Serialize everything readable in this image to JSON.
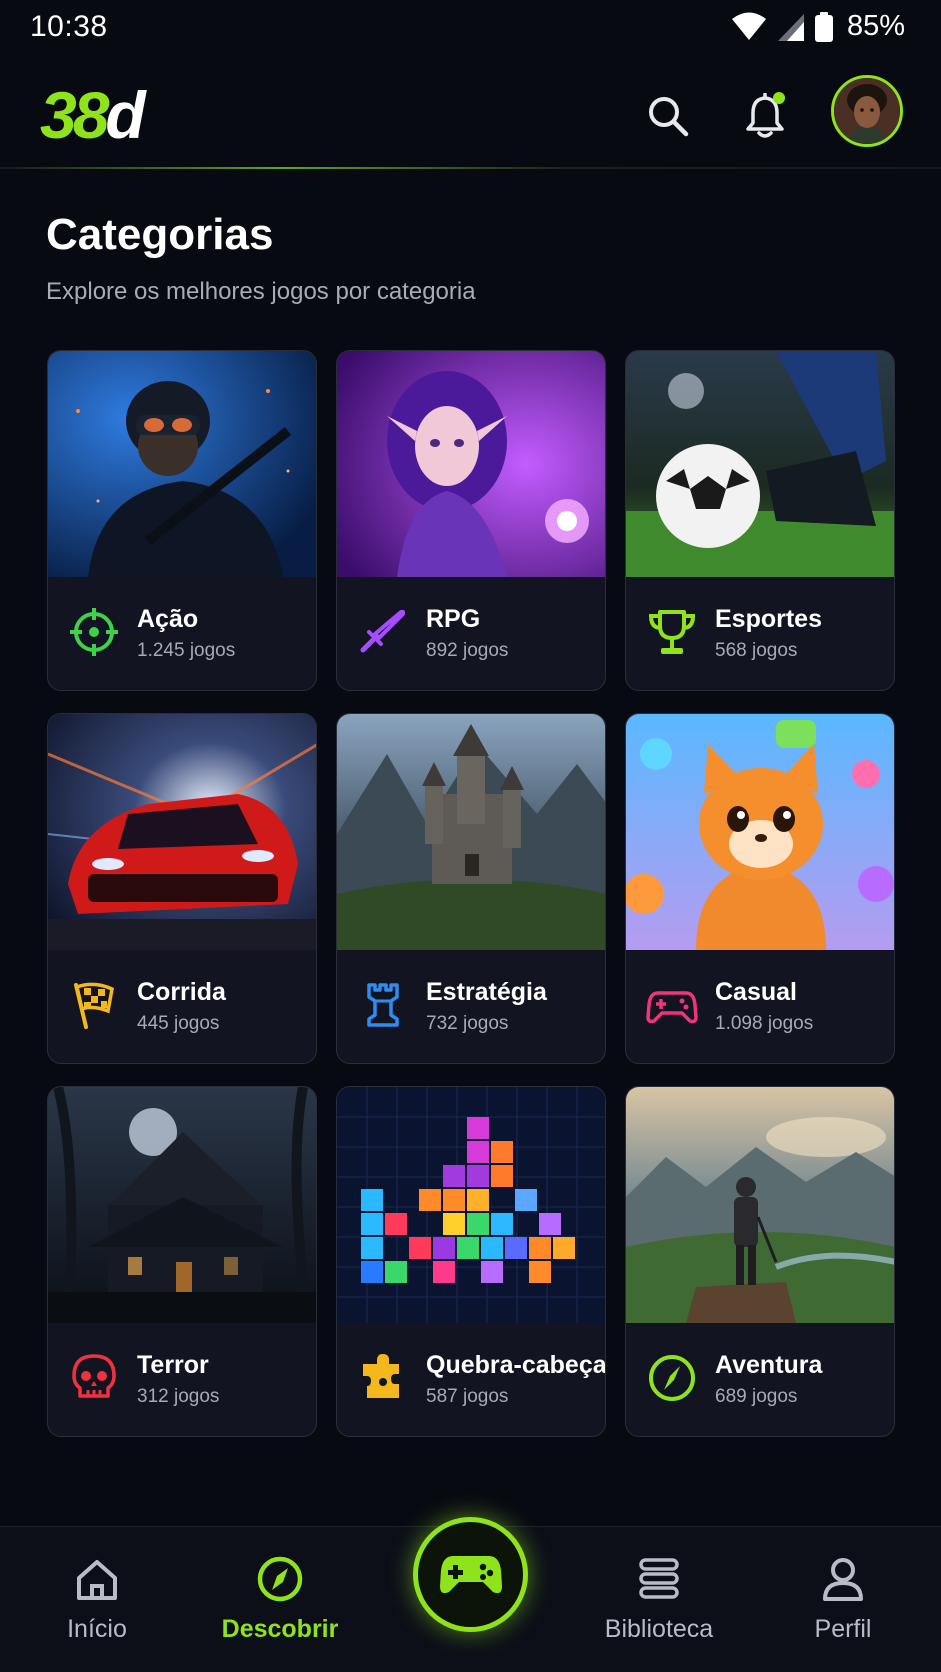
{
  "status_bar": {
    "time": "10:38",
    "battery": "85%"
  },
  "header": {
    "logo_number": "38",
    "logo_letter": "d"
  },
  "page": {
    "title": "Categorias",
    "subtitle": "Explore os melhores jogos por categoria"
  },
  "categories": [
    {
      "name": "Ação",
      "count": "1.245 jogos",
      "icon": "crosshair-icon",
      "icon_color": "#3fd14a"
    },
    {
      "name": "RPG",
      "count": "892 jogos",
      "icon": "sword-icon",
      "icon_color": "#a64dff"
    },
    {
      "name": "Esportes",
      "count": "568 jogos",
      "icon": "trophy-icon",
      "icon_color": "#8ee31b"
    },
    {
      "name": "Corrida",
      "count": "445 jogos",
      "icon": "checkered-flag-icon",
      "icon_color": "#f5b81c"
    },
    {
      "name": "Estratégia",
      "count": "732 jogos",
      "icon": "chess-rook-icon",
      "icon_color": "#2f8cf0"
    },
    {
      "name": "Casual",
      "count": "1.098 jogos",
      "icon": "gamepad-icon",
      "icon_color": "#f0347a"
    },
    {
      "name": "Terror",
      "count": "312 jogos",
      "icon": "skull-icon",
      "icon_color": "#f0323f"
    },
    {
      "name": "Quebra-cabeça",
      "count": "587 jogos",
      "icon": "puzzle-icon",
      "icon_color": "#f5b81c"
    },
    {
      "name": "Aventura",
      "count": "689 jogos",
      "icon": "compass-icon",
      "icon_color": "#8ee31b"
    }
  ],
  "bottom_nav": {
    "items": [
      {
        "label": "Início",
        "icon": "home-icon",
        "active": false
      },
      {
        "label": "Descobrir",
        "icon": "compass-icon",
        "active": true
      },
      {
        "label": "Biblioteca",
        "icon": "library-icon",
        "active": false
      },
      {
        "label": "Perfil",
        "icon": "user-icon",
        "active": false
      }
    ],
    "center_icon": "gamepad-icon"
  },
  "colors": {
    "accent": "#8ee31b",
    "background": "#080a12",
    "card": "#121521"
  }
}
